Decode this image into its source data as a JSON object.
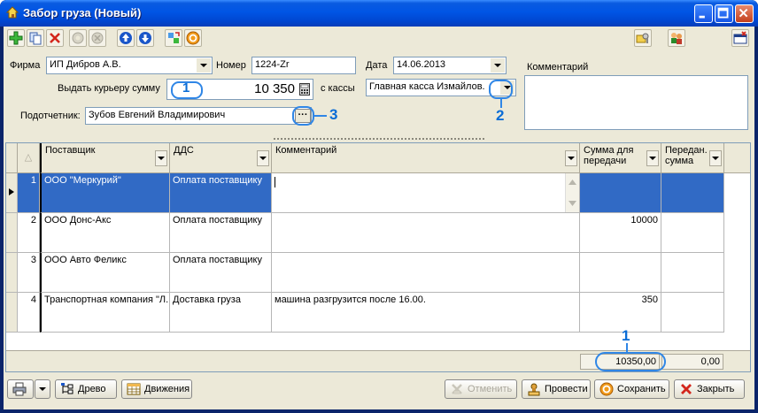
{
  "window": {
    "title": "Забор груза (Новый)"
  },
  "form": {
    "firm_label": "Фирма",
    "firm_value": "ИП Дибров А.В.",
    "number_label": "Номер",
    "number_value": "1224-Zr",
    "date_label": "Дата",
    "date_value": "14.06.2013",
    "comment_label": "Комментарий",
    "courier_label": "Выдать курьеру сумму",
    "courier_value": "10 350",
    "cashbox_label": "с кассы",
    "cashbox_value": "Главная касса Измайлов.",
    "accountable_label": "Подотчетник:",
    "accountable_value": "Зубов Евгений Владимирович",
    "ellipsis": "···"
  },
  "grid": {
    "sort_glyph": "△",
    "headers": {
      "supplier": "Поставщик",
      "dds": "ДДС",
      "comment": "Комментарий",
      "sum": "Сумма для передачи",
      "passed": "Передан. сумма"
    },
    "rows": [
      {
        "n": "1",
        "supplier": "ООО \"Меркурий\"",
        "dds": "Оплата поставщику",
        "comment": "",
        "sum": "",
        "passed": ""
      },
      {
        "n": "2",
        "supplier": "ООО Донс-Акс",
        "dds": "Оплата поставщику",
        "comment": "",
        "sum": "10000",
        "passed": ""
      },
      {
        "n": "3",
        "supplier": "ООО Авто Феликс",
        "dds": "Оплата поставщику",
        "comment": "",
        "sum": "",
        "passed": ""
      },
      {
        "n": "4",
        "supplier": "Транспортная компания \"Л.",
        "dds": "Доставка груза",
        "comment": "машина разгрузится после 16.00.",
        "sum": "350",
        "passed": ""
      }
    ],
    "totals": {
      "sum": "10350,00",
      "passed": "0,00"
    }
  },
  "buttons": {
    "tree": "Древо",
    "movements": "Движения",
    "cancel": "Отменить",
    "post": "Провести",
    "save": "Сохранить",
    "close": "Закрыть"
  },
  "annotations": {
    "a1": "1",
    "a2": "2",
    "a3": "3",
    "a1b": "1"
  },
  "colors": {
    "selection": "#316ac5",
    "annotation": "#2f86e6",
    "titlebar": "#0055e5"
  }
}
